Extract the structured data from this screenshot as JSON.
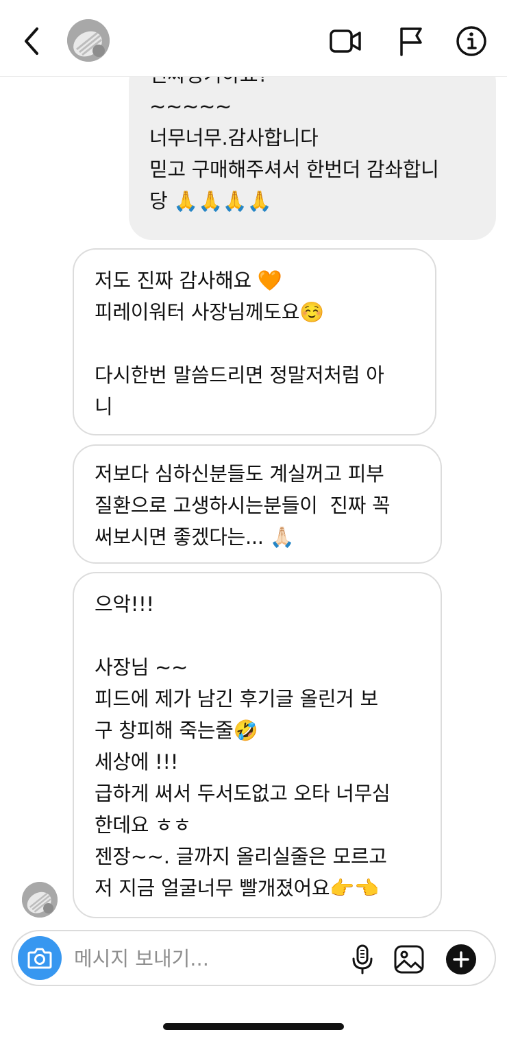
{
  "header": {
    "back_icon": "chevron-left-icon",
    "video_icon": "video-camera-icon",
    "flag_icon": "flag-icon",
    "info_icon": "info-icon"
  },
  "messages": {
    "outgoing": {
      "lines": [
        "신싸싱기하쇼?",
        "~~~~~",
        "너무너무.감사합니다",
        "믿고 구매해주셔서 한번더 감솨합니",
        "당 🙏🙏🙏🙏"
      ]
    },
    "incoming_1": {
      "lines": [
        "저도 진짜 감사해요 🧡",
        "피레이워터 사장님께도요☺️",
        "",
        "다시한번 말씀드리면 정말저처럼 아",
        "니"
      ]
    },
    "incoming_2": {
      "lines": [
        "저보다 심하신분들도 계실꺼고 피부",
        "질환으로 고생하시는분들이  진짜 꼭",
        "써보시면 좋겠다는... 🙏🏻"
      ]
    },
    "incoming_3": {
      "lines": [
        "으악!!!",
        "",
        "사장님 ~~",
        "피드에 제가 남긴 후기글 올린거 보",
        "구 창피해 죽는줄🤣",
        "세상에 !!!",
        "급하게 써서 두서도없고 오타 너무심",
        "한데요 ㅎㅎ",
        "젠장~~. 글까지 올리실줄은 모르고",
        "저 지금 얼굴너무 빨개졌어요👉👈"
      ]
    }
  },
  "composer": {
    "placeholder": "메시지 보내기...",
    "value": "",
    "camera_icon": "camera-icon",
    "mic_icon": "microphone-icon",
    "gallery_icon": "image-gallery-icon",
    "add_icon": "plus-circle-icon"
  },
  "colors": {
    "accent_blue": "#3797f0",
    "outgoing_bubble": "#efefef",
    "incoming_border": "#dcdcdc"
  }
}
